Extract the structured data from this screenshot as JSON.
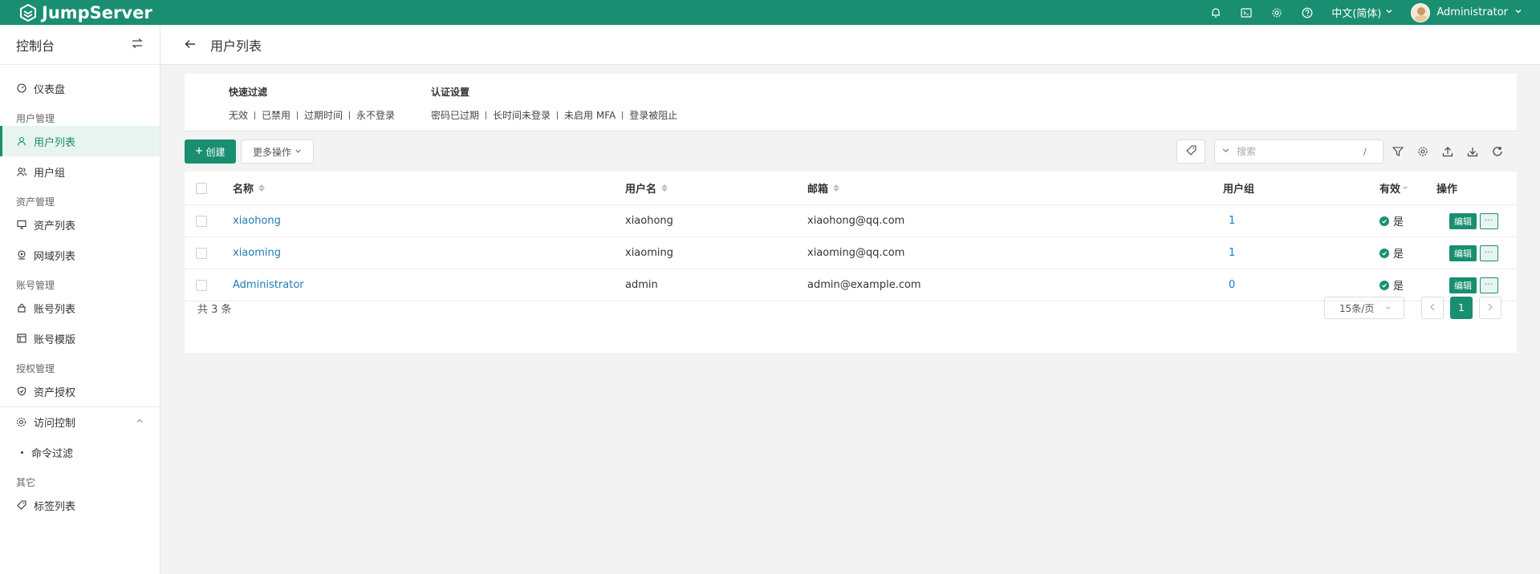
{
  "topbar": {
    "brand": "JumpServer",
    "language": "中文(简体)",
    "username": "Administrator"
  },
  "sidebar": {
    "title": "控制台",
    "dashboard": "仪表盘",
    "groups": {
      "users": "用户管理",
      "assets": "资产管理",
      "accounts": "账号管理",
      "perms": "授权管理",
      "other": "其它"
    },
    "items": {
      "user_list": "用户列表",
      "user_group": "用户组",
      "asset_list": "资产列表",
      "zone_list": "网域列表",
      "account_list": "账号列表",
      "account_template": "账号模版",
      "asset_perm": "资产授权",
      "access_control": "访问控制",
      "command_filter": "命令过滤",
      "label_list": "标签列表"
    }
  },
  "page": {
    "title": "用户列表"
  },
  "filters": {
    "quick": {
      "title": "快速过滤",
      "items": [
        "无效",
        "已禁用",
        "过期时间",
        "永不登录"
      ]
    },
    "auth": {
      "title": "认证设置",
      "items": [
        "密码已过期",
        "长时间未登录",
        "未启用 MFA",
        "登录被阻止"
      ]
    }
  },
  "toolbar": {
    "create": "创建",
    "more": "更多操作",
    "search_placeholder": "搜索",
    "search_shortcut": "/"
  },
  "table": {
    "columns": {
      "name": "名称",
      "username": "用户名",
      "email": "邮箱",
      "groups": "用户组",
      "valid": "有效",
      "actions": "操作"
    },
    "rows": [
      {
        "name": "xiaohong",
        "username": "xiaohong",
        "email": "xiaohong@qq.com",
        "groups": "1",
        "valid": "是",
        "edit": "编辑",
        "more": "···"
      },
      {
        "name": "xiaoming",
        "username": "xiaoming",
        "email": "xiaoming@qq.com",
        "groups": "1",
        "valid": "是",
        "edit": "编辑",
        "more": "···"
      },
      {
        "name": "Administrator",
        "username": "admin",
        "email": "admin@example.com",
        "groups": "0",
        "valid": "是",
        "edit": "编辑",
        "more": "···"
      }
    ],
    "total": "共 3 条",
    "page_size": "15条/页",
    "current_page": "1"
  }
}
